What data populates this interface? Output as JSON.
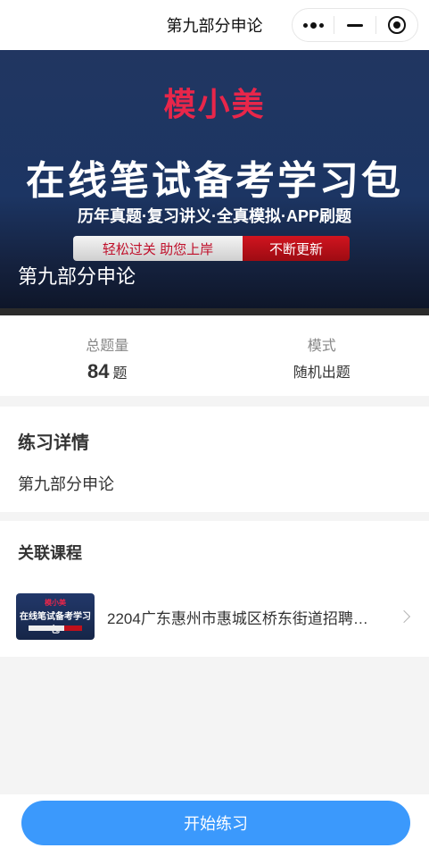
{
  "navbar": {
    "title": "第九部分申论"
  },
  "banner": {
    "brand": "模小美",
    "headline": "在线笔试备考学习包",
    "subline": "历年真题·复习讲义·全真模拟·APP刷题",
    "pill_left": "轻松过关  助您上岸",
    "pill_right": "不断更新",
    "caption": "第九部分申论"
  },
  "stats": {
    "total_label": "总题量",
    "total_value": "84",
    "total_unit": "题",
    "mode_label": "模式",
    "mode_value": "随机出题"
  },
  "details": {
    "title": "练习详情",
    "body": "第九部分申论"
  },
  "related": {
    "title": "关联课程",
    "course": {
      "thumb_brand": "模小美",
      "thumb_headline": "在线笔试备考学习包",
      "name": "2204广东惠州市惠城区桥东街道招聘…"
    }
  },
  "footer": {
    "start_label": "开始练习"
  },
  "colors": {
    "primary": "#3b99fc",
    "brand_red": "#e8264a",
    "banner_bg": "#1c3563"
  }
}
